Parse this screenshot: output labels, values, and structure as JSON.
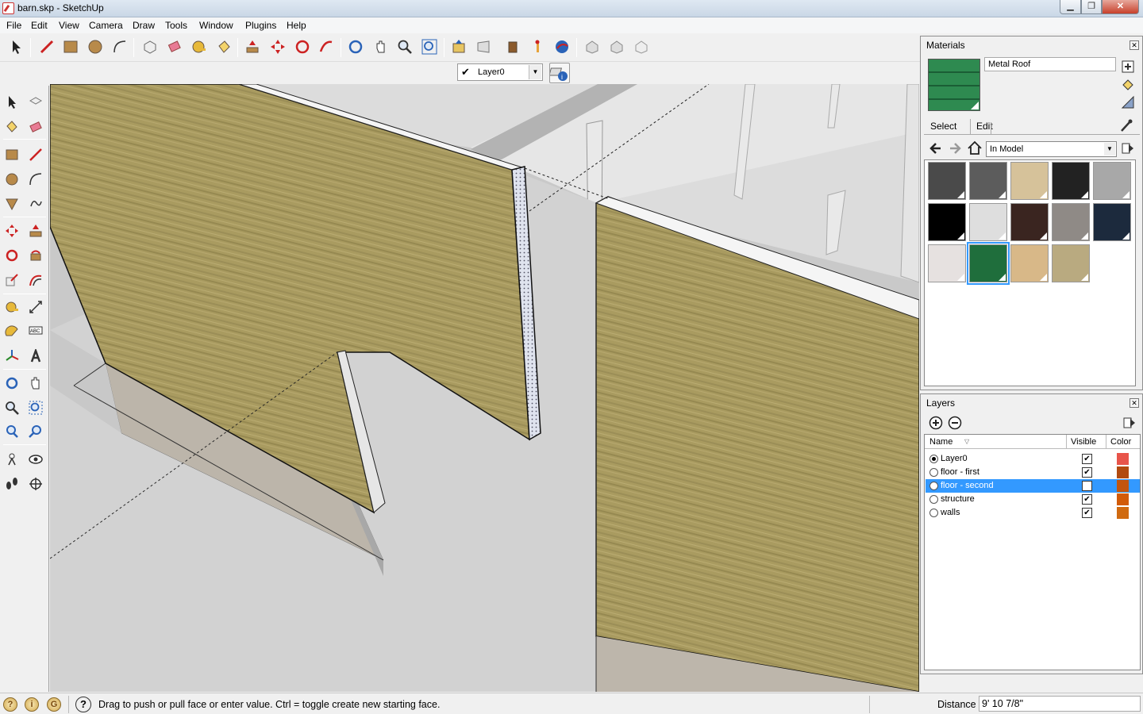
{
  "window": {
    "title": "barn.skp - SketchUp"
  },
  "menu": [
    "File",
    "Edit",
    "View",
    "Camera",
    "Draw",
    "Tools",
    "Window",
    "Plugins",
    "Help"
  ],
  "layer_toolbar": {
    "current_layer": "Layer0"
  },
  "materials": {
    "panel_title": "Materials",
    "current_material": "Metal Roof",
    "tabs": [
      "Select",
      "Edit"
    ],
    "collection": "In Model",
    "swatches": [
      {
        "color": "#4a4a4a"
      },
      {
        "color": "#5c5c5c"
      },
      {
        "color": "#d6c29a"
      },
      {
        "color": "#222222"
      },
      {
        "color": "#a8a8a8"
      },
      {
        "color": "#000000"
      },
      {
        "color": "#dedede"
      },
      {
        "color": "#3a2520"
      },
      {
        "color": "#8f8a86"
      },
      {
        "color": "#1c2a3d"
      },
      {
        "color": "#e6e1e0"
      },
      {
        "color": "#1f6e3c",
        "selected": true
      },
      {
        "color": "#d8b888"
      },
      {
        "color": "#b9aa80"
      }
    ]
  },
  "layers": {
    "panel_title": "Layers",
    "columns": {
      "name": "Name",
      "visible": "Visible",
      "color": "Color"
    },
    "rows": [
      {
        "name": "Layer0",
        "active": true,
        "visible": true,
        "color": "#e8544a"
      },
      {
        "name": "floor - first",
        "active": false,
        "visible": true,
        "color": "#b24a0f"
      },
      {
        "name": "floor - second",
        "active": false,
        "visible": false,
        "color": "#c2550f",
        "selected": true
      },
      {
        "name": "structure",
        "active": false,
        "visible": true,
        "color": "#d25b08"
      },
      {
        "name": "walls",
        "active": false,
        "visible": true,
        "color": "#d06a10"
      }
    ]
  },
  "status": {
    "help_text": "Drag to push or pull face or enter value.  Ctrl = toggle create new starting face.",
    "vcb_label": "Distance",
    "vcb_value": "9' 10 7/8\""
  },
  "colors": {
    "selection": "#3399ff",
    "wood": "#a89a5e",
    "sky": "#ffffff",
    "ground": "#cfcfcf"
  }
}
